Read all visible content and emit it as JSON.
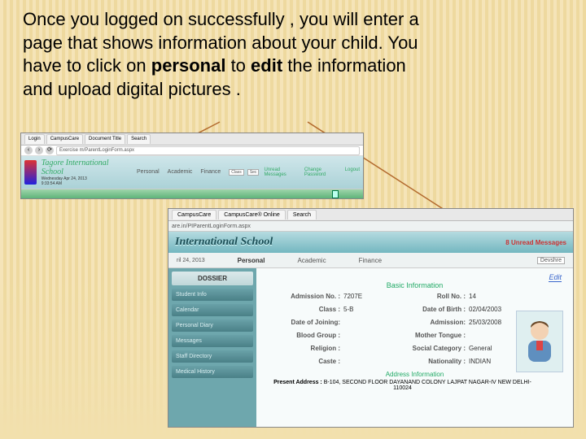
{
  "instruction": {
    "line1": "Once you  logged on successfully , you will enter a",
    "line2": "page that shows information about your child. You",
    "line3_a": "have to click on ",
    "line3_b": "personal",
    "line3_c": " to ",
    "line3_d": "edit",
    "line3_e": " the information",
    "line4": "and upload digital pictures ."
  },
  "shot1": {
    "tabs": [
      "Login",
      "CampusCare",
      "Document Title",
      "Search"
    ],
    "url": "Exercise m/ParentLoginForm.aspx",
    "school": "Tagore International School",
    "date1": "Wednesday Apr 24, 2013",
    "date2": "9:33:54 AM",
    "menu": [
      "Personal",
      "Academic",
      "Finance"
    ],
    "right_links": [
      "Unread Messages",
      "Change Password",
      "Logout"
    ],
    "select1": "Class",
    "select2": "Sec"
  },
  "shot2": {
    "tabs": [
      "CampusCare",
      "CampusCare® Online",
      "Search"
    ],
    "url": "are.in/PIParentLoginForm.aspx",
    "title": "International School",
    "unread": "8 Unread Messages",
    "date": "ril 24, 2013",
    "menu": [
      "Personal",
      "Academic",
      "Finance"
    ],
    "session": "Devshre",
    "dossier": "DOSSIER",
    "sidebar": [
      "Student Info",
      "Calendar",
      "Personal Diary",
      "Messages",
      "Staff Directory",
      "Medical History"
    ],
    "edit": "Edit",
    "section1": "Basic Information",
    "fields": {
      "admission_no_l": "Admission No. :",
      "admission_no_v": "7207E",
      "roll_no_l": "Roll No. :",
      "roll_no_v": "14",
      "class_l": "Class :",
      "class_v": "5-B",
      "dob_l": "Date of Birth :",
      "dob_v": "02/04/2003",
      "doj_l": "Date of Joining:",
      "doj_v": "",
      "doa_l": "Admission:",
      "doa_v": "25/03/2008",
      "blood_l": "Blood Group :",
      "blood_v": "",
      "mother_l": "Mother Tongue :",
      "mother_v": "",
      "religion_l": "Religion :",
      "religion_v": "",
      "social_l": "Social Category :",
      "social_v": "General",
      "caste_l": "Caste :",
      "caste_v": "",
      "nat_l": "Nationality :",
      "nat_v": "INDIAN"
    },
    "section2": "Address Information",
    "address_l": "Present Address :",
    "address_v": "B-104, SECOND FLOOR DAYANAND COLONY LAJPAT NAGAR-IV NEW DELHI-110024"
  }
}
